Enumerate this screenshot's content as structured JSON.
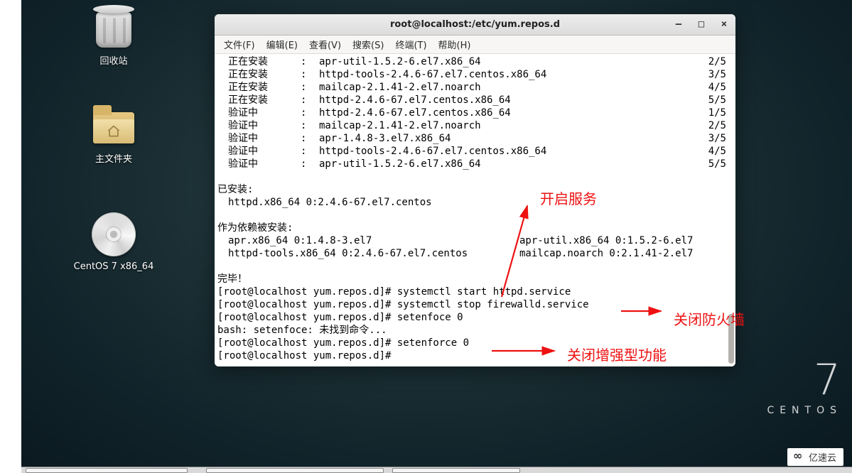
{
  "desktop": {
    "trash_label": "回收站",
    "home_label": "主文件夹",
    "disc_label": "CentOS 7 x86_64"
  },
  "branding": {
    "seven": "7",
    "name": "CENTOS"
  },
  "watermark": "亿速云",
  "terminal_window": {
    "title": "root@localhost:/etc/yum.repos.d",
    "win": {
      "minimize": "—",
      "maximize": "□",
      "close": "×"
    },
    "menus": [
      "文件(F)",
      "编辑(E)",
      "查看(V)",
      "搜索(S)",
      "终端(T)",
      "帮助(H)"
    ]
  },
  "pkg_rows": [
    {
      "stage": "正在安装",
      "sep": ":",
      "pkg": "apr-util-1.5.2-6.el7.x86_64",
      "count": "2/5"
    },
    {
      "stage": "正在安装",
      "sep": ":",
      "pkg": "httpd-tools-2.4.6-67.el7.centos.x86_64",
      "count": "3/5"
    },
    {
      "stage": "正在安装",
      "sep": ":",
      "pkg": "mailcap-2.1.41-2.el7.noarch",
      "count": "4/5"
    },
    {
      "stage": "正在安装",
      "sep": ":",
      "pkg": "httpd-2.4.6-67.el7.centos.x86_64",
      "count": "5/5"
    },
    {
      "stage": "验证中",
      "sep": ":",
      "pkg": "httpd-2.4.6-67.el7.centos.x86_64",
      "count": "1/5"
    },
    {
      "stage": "验证中",
      "sep": ":",
      "pkg": "mailcap-2.1.41-2.el7.noarch",
      "count": "2/5"
    },
    {
      "stage": "验证中",
      "sep": ":",
      "pkg": "apr-1.4.8-3.el7.x86_64",
      "count": "3/5"
    },
    {
      "stage": "验证中",
      "sep": ":",
      "pkg": "httpd-tools-2.4.6-67.el7.centos.x86_64",
      "count": "4/5"
    },
    {
      "stage": "验证中",
      "sep": ":",
      "pkg": "apr-util-1.5.2-6.el7.x86_64",
      "count": "5/5"
    }
  ],
  "installed_header": "已安装:",
  "installed_line": "httpd.x86_64 0:2.4.6-67.el7.centos",
  "dep_header": "作为依赖被安装:",
  "dep_rows": [
    {
      "left": "apr.x86_64 0:1.4.8-3.el7",
      "right": "apr-util.x86_64 0:1.5.2-6.el7"
    },
    {
      "left": "httpd-tools.x86_64 0:2.4.6-67.el7.centos",
      "right": "mailcap.noarch 0:2.1.41-2.el7"
    }
  ],
  "done": "完毕！",
  "prompt_lines": [
    "[root@localhost yum.repos.d]# systemctl start httpd.service",
    "[root@localhost yum.repos.d]# systemctl stop firewalld.service",
    "[root@localhost yum.repos.d]# setenfoce 0",
    "bash: setenfoce: 未找到命令...",
    "[root@localhost yum.repos.d]# setenforce 0",
    "[root@localhost yum.repos.d]# "
  ],
  "annotations": {
    "start": "开启服务",
    "firewall": "关闭防火墙",
    "selinux": "关闭增强型功能"
  }
}
